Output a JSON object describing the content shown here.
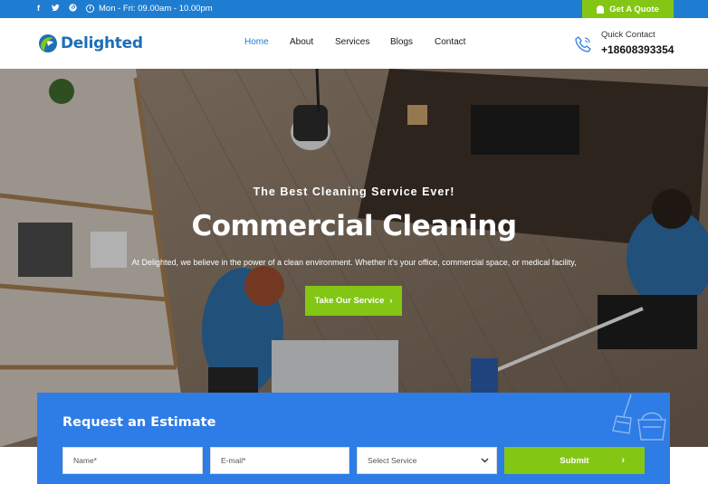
{
  "topbar": {
    "social": [
      "f",
      "t",
      "p"
    ],
    "hours": "Mon - Fri: 09.00am - 10.00pm",
    "quote_label": "Get A Quote",
    "color": "#1f7dd1",
    "accent": "#84c614"
  },
  "header": {
    "logo_text": "Delighted",
    "nav": [
      "Home",
      "About",
      "Services",
      "Blogs",
      "Contact"
    ],
    "active_nav": "Home",
    "contact_label": "Quick Contact",
    "contact_phone": "+18608393354"
  },
  "hero": {
    "tagline": "The Best Cleaning Service Ever!",
    "title": "Commercial Cleaning",
    "description": "At Delighted, we believe in the power of a clean environment. Whether it's your office, commercial space, or medical facility,",
    "cta_label": "Take Our Service"
  },
  "estimate": {
    "title": "Request an Estimate",
    "name_placeholder": "Name*",
    "email_placeholder": "E-mail*",
    "service_select": "Select Service",
    "submit_label": "Submit",
    "color": "#2e7ce6"
  },
  "icons": [
    "facebook-icon",
    "twitter-icon",
    "pinterest-icon",
    "clock-icon",
    "bell-icon",
    "phone-icon",
    "chevron-right-icon",
    "chevron-down-icon",
    "broom-icon",
    "bucket-icon"
  ]
}
